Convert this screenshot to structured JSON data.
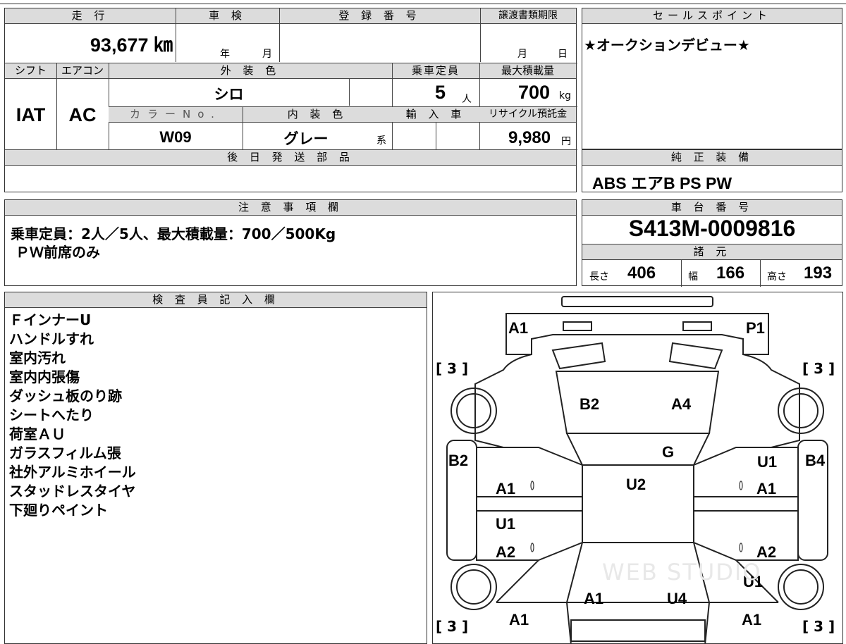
{
  "headers": {
    "mileage": "走 行",
    "shaken": "車 検",
    "registration": "登 録 番 号",
    "transfer_deadline": "譲渡書類期限",
    "sales_point": "セールスポイント",
    "shift": "シフト",
    "aircon": "エアコン",
    "exterior_color": "外 装 色",
    "capacity": "乗車定員",
    "max_load": "最大積載量",
    "color_no": "カラーNo.",
    "interior_color": "内 装 色",
    "import": "輸 入 車",
    "recycle": "リサイクル預託金",
    "later_parts": "後 日 発 送 部 品",
    "standard_equipment": "純 正 装 備",
    "notes": "注 意 事 項 欄",
    "chassis_number": "車 台 番 号",
    "specs": "諸 元",
    "inspector": "検 査 員 記 入 欄"
  },
  "values": {
    "mileage": "93,677 ㎞",
    "shaken_year": "年",
    "shaken_month": "月",
    "transfer_month": "月",
    "transfer_day": "日",
    "sales_point": "★オークションデビュー★",
    "shift": "IAT",
    "aircon": "AC",
    "exterior_color": "シロ",
    "capacity_num": "5",
    "capacity_unit": "人",
    "max_load_num": "700",
    "max_load_unit": "kg",
    "color_no": "W09",
    "interior_color": "グレー",
    "interior_suffix": "系",
    "recycle_num": "9,980",
    "recycle_unit": "円",
    "standard_equipment": "ABS エアB PS PW",
    "notes_line1": "乗車定員：2人／5人、最大積載量：700／500Kg",
    "notes_line2": " ＰＷ前席のみ",
    "chassis_number": "S413M-0009816",
    "length_label": "長さ",
    "length_value": "406",
    "width_label": "幅",
    "width_value": "166",
    "height_label": "高さ",
    "height_value": "193"
  },
  "inspector_notes": [
    "ＦインナーU",
    "ハンドルすれ",
    "室内汚れ",
    "室内内張傷",
    "ダッシュ板のり跡",
    "シートへたり",
    "荷室ＡＵ",
    "ガラスフィルム張",
    "社外アルミホイール",
    "スタッドレスタイヤ",
    "下廻りペイント"
  ],
  "diagram": {
    "labels": {
      "front_left": "A1",
      "front_right": "P1",
      "hood_left": "B2",
      "hood_right": "A4",
      "windshield": "G",
      "roof": "U2",
      "left_fender": "B2",
      "right_fender": "B4",
      "left_front_door": "A1",
      "right_front_door_upper": "U1",
      "right_front_door": "A1",
      "left_rear_door_upper": "U1",
      "left_rear_door": "A2",
      "right_rear_door": "A2",
      "right_rear_quarter": "U1",
      "rear_left": "A1",
      "rear_right": "U4",
      "left_bottom": "A1",
      "right_bottom": "A1"
    },
    "bracket_tl": "[ 3 ]",
    "bracket_tr": "[ 3 ]",
    "bracket_bl": "[ 3 ]",
    "bracket_br": "[ 3 ]",
    "watermark": "WEB STUDIO"
  }
}
